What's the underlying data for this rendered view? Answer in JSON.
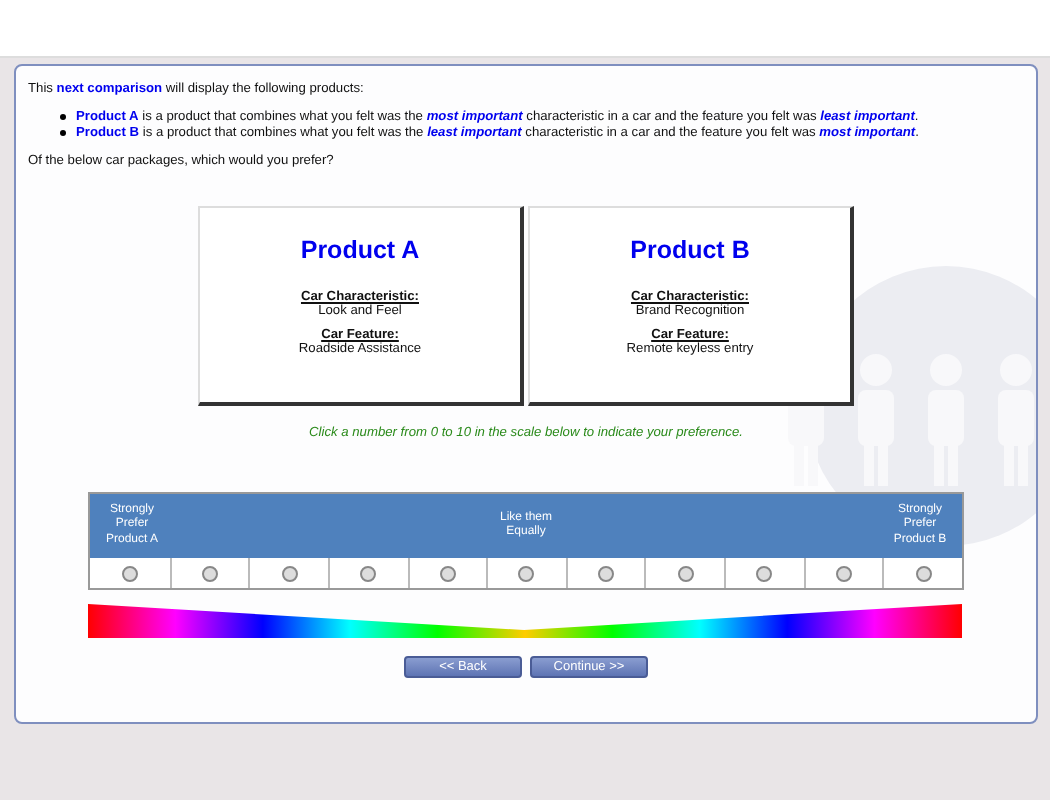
{
  "intro": "This **next comparison** will display the following products:",
  "bullets": [
    "**Product A** is a product that combines what you felt was the *most important* characteristic in a car and the feature you felt was *least important*.",
    "**Product B** is a product that combines what you felt was the *least important* characteristic in a car and the feature you felt was *most important*."
  ],
  "question": "Of the below car packages, which would you prefer?",
  "products": [
    {
      "title": "Product A",
      "characteristic_label": "Car Characteristic:",
      "characteristic": "Look and Feel",
      "feature_label": "Car Feature:",
      "feature": "Roadside Assistance"
    },
    {
      "title": "Product B",
      "characteristic_label": "Car Characteristic:",
      "characteristic": "Brand Recognition",
      "feature_label": "Car Feature:",
      "feature": "Remote keyless entry"
    }
  ],
  "instruction": "Click a number from 0 to 10 in the scale below to indicate your preference.",
  "scale": {
    "left_label": "Strongly Prefer Product A",
    "center_label": "Like them Equally",
    "right_label": "Strongly Prefer Product B",
    "options": [
      {
        "selected": false
      },
      {
        "selected": false
      },
      {
        "selected": false
      },
      {
        "selected": false
      },
      {
        "selected": false
      },
      {
        "selected": false
      },
      {
        "selected": false
      },
      {
        "selected": false
      },
      {
        "selected": false
      },
      {
        "selected": false
      },
      {
        "selected": false
      }
    ]
  },
  "buttons": [
    "<< Back",
    "Continue >>"
  ]
}
